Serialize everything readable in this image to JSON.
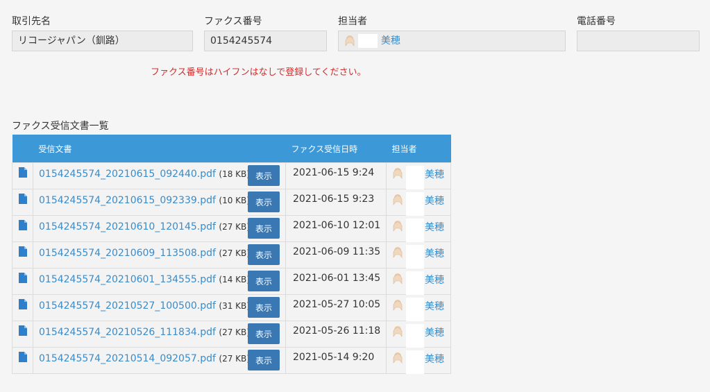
{
  "fields": {
    "partner_label": "取引先名",
    "partner_value": "リコージャパン（釧路）",
    "fax_label": "ファクス番号",
    "fax_value": "0154245574",
    "owner_label": "担当者",
    "owner_name": "美穂",
    "phone_label": "電話番号",
    "phone_value": ""
  },
  "warning": "ファクス番号はハイフンはなしで登録してください。",
  "section_title": "ファクス受信文書一覧",
  "table": {
    "headers": [
      "",
      "受信文書",
      "ファクス受信日時",
      "担当者"
    ],
    "button_label": "表示",
    "rows": [
      {
        "file": "0154245574_20210615_092440.pdf",
        "size": "(18 KB)",
        "datetime": "2021-06-15 9:24",
        "person": "美穂"
      },
      {
        "file": "0154245574_20210615_092339.pdf",
        "size": "(10 KB)",
        "datetime": "2021-06-15 9:23",
        "person": "美穂"
      },
      {
        "file": "0154245574_20210610_120145.pdf",
        "size": "(27 KB)",
        "datetime": "2021-06-10 12:01",
        "person": "美穂"
      },
      {
        "file": "0154245574_20210609_113508.pdf",
        "size": "(27 KB)",
        "datetime": "2021-06-09 11:35",
        "person": "美穂"
      },
      {
        "file": "0154245574_20210601_134555.pdf",
        "size": "(14 KB)",
        "datetime": "2021-06-01 13:45",
        "person": "美穂"
      },
      {
        "file": "0154245574_20210527_100500.pdf",
        "size": "(31 KB)",
        "datetime": "2021-05-27 10:05",
        "person": "美穂"
      },
      {
        "file": "0154245574_20210526_111834.pdf",
        "size": "(27 KB)",
        "datetime": "2021-05-26 11:18",
        "person": "美穂"
      },
      {
        "file": "0154245574_20210514_092057.pdf",
        "size": "(27 KB)",
        "datetime": "2021-05-14 9:20",
        "person": "美穂"
      }
    ]
  },
  "colors": {
    "header_bg": "#3d98d8",
    "link": "#3a8bc8",
    "button_bg": "#3a78b4",
    "warning": "#d62b2b",
    "doc_icon": "#2f7fcb"
  },
  "icons": {
    "document": "file-document-icon",
    "avatar": "user-avatar-icon"
  }
}
